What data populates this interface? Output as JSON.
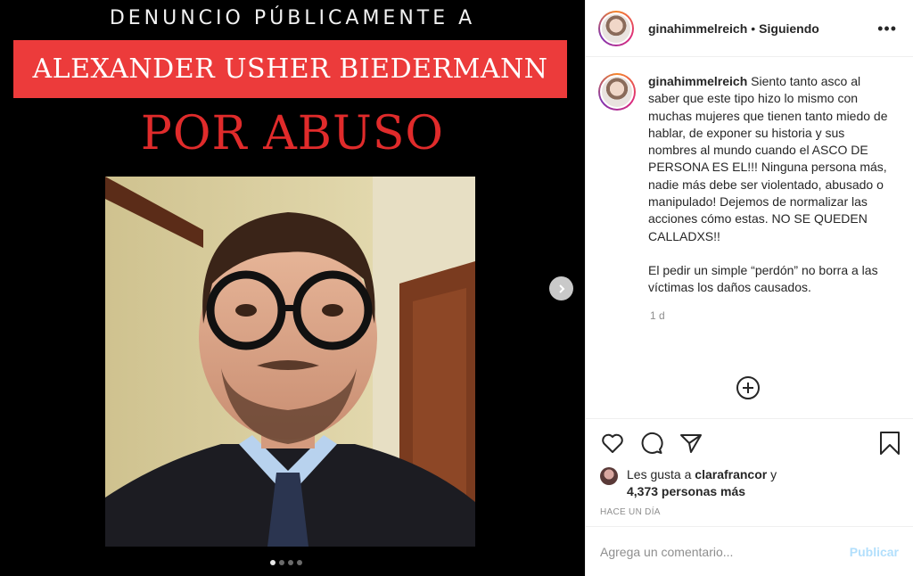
{
  "post": {
    "media": {
      "top_text": "DENUNCIO PÚBLICAMENTE A",
      "name_banner": "ALEXANDER USHER BIEDERMANN",
      "headline": "POR ABUSO",
      "carousel_total": 4,
      "carousel_active": 1
    },
    "header": {
      "username": "ginahimmelreich",
      "separator": "•",
      "follow_status": "Siguiendo",
      "more_label": "•••"
    },
    "caption": {
      "username": "ginahimmelreich",
      "paragraph1": "Siento tanto asco al saber que este tipo hizo lo mismo con muchas mujeres que tienen tanto miedo de hablar, de exponer su historia y sus nombres al mundo cuando el ASCO DE PERSONA ES EL!!! Ninguna persona más, nadie más debe ser violentado, abusado o manipulado! Dejemos de normalizar las acciones cómo estas. NO SE QUEDEN CALLADXS!!",
      "paragraph2": "El pedir un simple “perdón” no borra a las víctimas los daños causados.",
      "time": "1 d"
    },
    "likes": {
      "prefix": "Les gusta a",
      "user": "clarafrancor",
      "joiner": "y",
      "others": "4,373 personas más"
    },
    "time_ago": "HACE UN DÍA",
    "comment": {
      "placeholder": "Agrega un comentario...",
      "publish_label": "Publicar"
    }
  },
  "icons": [
    "heart-icon",
    "comment-icon",
    "share-icon",
    "bookmark-icon",
    "plus-circle-icon",
    "chevron-right-icon"
  ],
  "colors": {
    "banner_red": "#ec3b3b",
    "headline_red": "#e02b2b",
    "publish_blue": "#b2dffc"
  }
}
